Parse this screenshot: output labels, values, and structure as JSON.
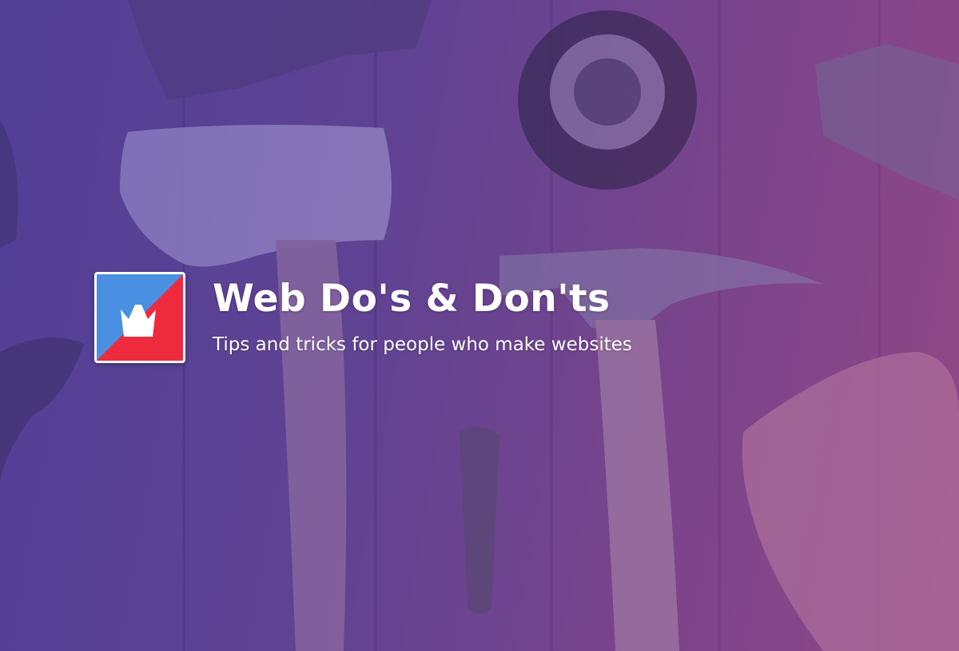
{
  "site": {
    "title": "Web Do's & Don'ts",
    "tagline": "Tips and tricks for people who make websites"
  },
  "logo": {
    "name": "crown-logo-icon",
    "colors": {
      "blue": "#4a90e2",
      "red": "#ee2b3c",
      "mark": "#ffffff"
    }
  },
  "background": {
    "description_colors": {
      "overlay_left": "#4a3a8e",
      "overlay_right": "#95467f",
      "wood": "#6a4e8a"
    }
  }
}
